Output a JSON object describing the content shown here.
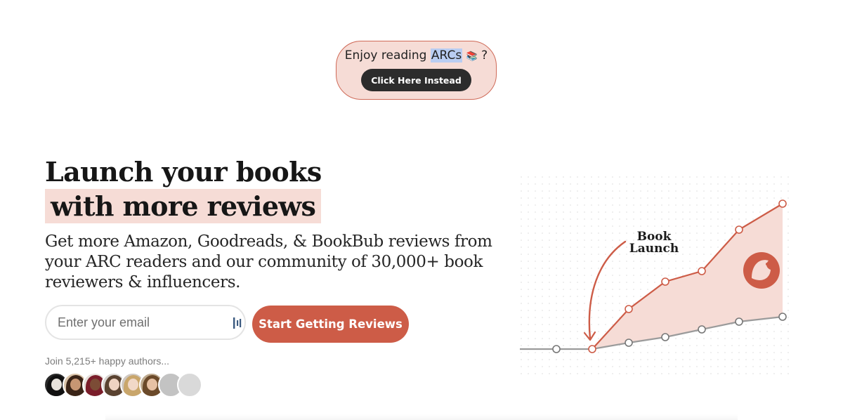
{
  "banner": {
    "text_before": "Enjoy reading ",
    "highlight": "ARCs",
    "emoji": "📚",
    "text_after": " ?",
    "button_label": "Click Here Instead"
  },
  "hero": {
    "title_line1": "Launch your books",
    "title_line2": "with more reviews",
    "subtitle": "Get more Amazon, Goodreads, & BookBub reviews from your ARC readers and our community of 30,000+ book reviewers & influencers."
  },
  "form": {
    "email_placeholder": "Enter your email",
    "submit_label": "Start Getting Reviews"
  },
  "social_proof": {
    "text": "Join 5,215+ happy authors..."
  },
  "illustration": {
    "annotation_line1": "Book",
    "annotation_line2": "Launch"
  },
  "colors": {
    "accent": "#cd5c47",
    "highlight_bg": "#f6dcd6",
    "dark_button": "#2c2c2c"
  }
}
